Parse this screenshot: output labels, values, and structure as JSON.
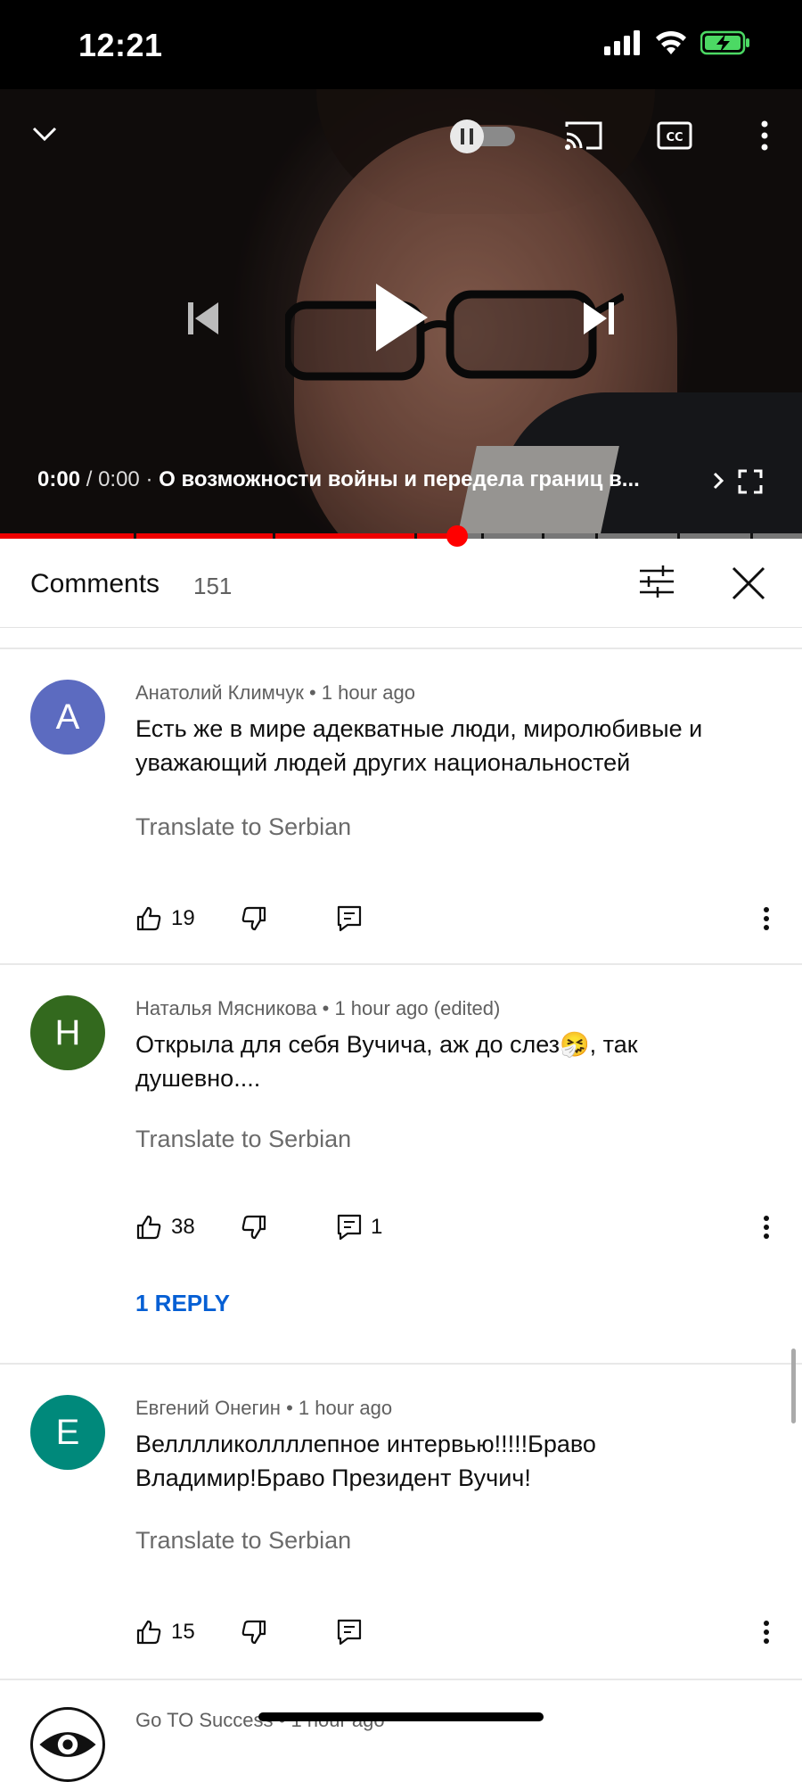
{
  "status_bar": {
    "time": "12:21"
  },
  "player": {
    "time_current": "0:00",
    "time_separator": "/",
    "time_total": "0:00",
    "dot": "·",
    "title": "О возможности войны и передела границ в...",
    "progress_fraction": 0.57,
    "icons": [
      "chevron-down-icon",
      "autoplay-toggle-icon",
      "cast-icon",
      "captions-icon",
      "more-vert-icon",
      "previous-icon",
      "play-icon",
      "next-icon",
      "chevron-right-icon",
      "fullscreen-icon"
    ]
  },
  "comments_header": {
    "title": "Comments",
    "count": "151"
  },
  "comments": [
    {
      "avatar_letter": "A",
      "avatar_color": "#5c6bc0",
      "author": "Анатолий Климчук",
      "meta_sep": "•",
      "time": "1 hour ago",
      "text": "Есть же в мире адекватные люди, миролюбивые и уважающий людей других национальностей",
      "translate": "Translate to Serbian",
      "likes": "19",
      "replies_count": ""
    },
    {
      "avatar_letter": "Н",
      "avatar_color": "#33691e",
      "author": "Наталья Мясникова",
      "meta_sep": "•",
      "time": "1 hour ago (edited)",
      "text": "Открыла для себя Вучича, аж до слез🤧, так душевно....",
      "translate": "Translate to Serbian",
      "likes": "38",
      "replies_count": "1",
      "reply_link": "1 REPLY"
    },
    {
      "avatar_letter": "Е",
      "avatar_color": "#00897b",
      "author": "Евгений Онегин",
      "meta_sep": "•",
      "time": "1 hour ago",
      "text": "Велллликоллллепное интервью!!!!!Браво Владимир!Браво Президент Вучич!",
      "translate": "Translate to Serbian",
      "likes": "15",
      "replies_count": ""
    },
    {
      "author": "Go TO Success",
      "meta_sep": "•",
      "time": "1 hour ago"
    }
  ]
}
